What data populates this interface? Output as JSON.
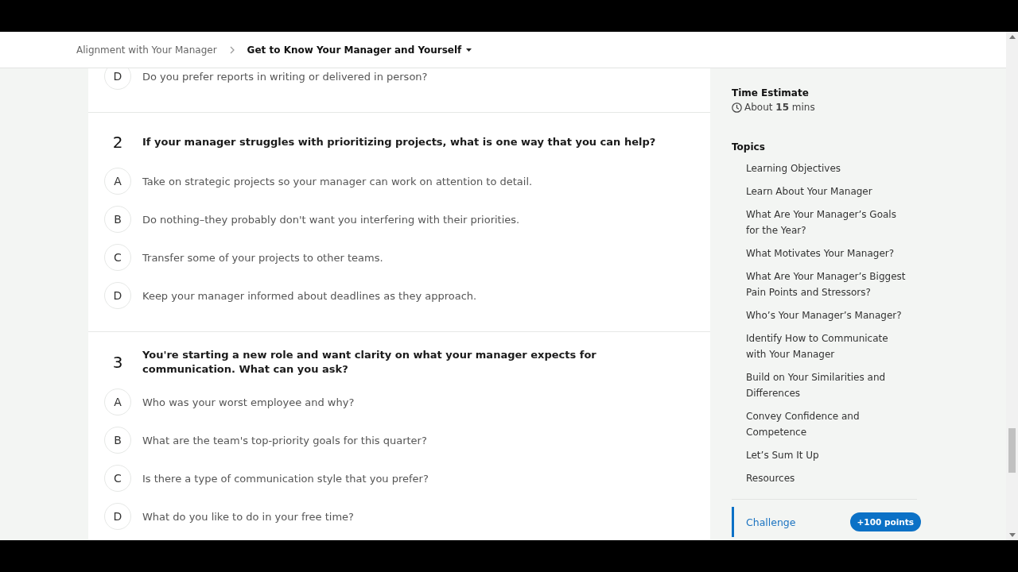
{
  "breadcrumbs": [
    {
      "label": "Alignment with Your Manager",
      "current": false
    },
    {
      "label": "Get to Know Your Manager and Yourself",
      "current": true
    }
  ],
  "questions": [
    {
      "options": [
        {
          "letter": "D",
          "text": "Do you prefer reports in writing or delivered in person?"
        }
      ]
    },
    {
      "number": "2",
      "prompt": "If your manager struggles with prioritizing projects, what is one way that you can help?",
      "options": [
        {
          "letter": "A",
          "text": "Take on strategic projects so your manager can work on attention to detail."
        },
        {
          "letter": "B",
          "text": "Do nothing–they probably don't want you interfering with their priorities."
        },
        {
          "letter": "C",
          "text": "Transfer some of your projects to other teams."
        },
        {
          "letter": "D",
          "text": "Keep your manager informed about deadlines as they approach."
        }
      ]
    },
    {
      "number": "3",
      "prompt": "You're starting a new role and want clarity on what your manager expects for communication. What can you ask?",
      "options": [
        {
          "letter": "A",
          "text": "Who was your worst employee and why?"
        },
        {
          "letter": "B",
          "text": "What are the team's top-priority goals for this quarter?"
        },
        {
          "letter": "C",
          "text": "Is there a type of communication style that you prefer?"
        },
        {
          "letter": "D",
          "text": "What do you like to do in your free time?"
        }
      ]
    }
  ],
  "sidebar": {
    "time_estimate": {
      "title": "Time Estimate",
      "value": "About **15** mins"
    },
    "topics_title": "Topics",
    "topics": [
      {
        "label": "Learning Objectives",
        "selected": false
      },
      {
        "label": "Learn About Your Manager",
        "selected": false
      },
      {
        "label": "What Are Your Manager’s Goals for the Year?",
        "selected": false
      },
      {
        "label": "What Motivates Your Manager?",
        "selected": false
      },
      {
        "label": "What Are Your Manager’s Biggest Pain Points and Stressors?",
        "selected": false
      },
      {
        "label": "Who’s Your Manager’s Manager?",
        "selected": false
      },
      {
        "label": "Identify How to Communicate with Your Manager",
        "selected": false
      },
      {
        "label": "Build on Your Similarities and Differences",
        "selected": false
      },
      {
        "label": "Convey Confidence and Competence",
        "selected": false
      },
      {
        "label": "Let’s Sum It Up",
        "selected": false
      },
      {
        "label": "Resources",
        "selected": false
      }
    ],
    "challenge": {
      "label": "Challenge",
      "badge": "+100 points",
      "selected": true
    }
  }
}
